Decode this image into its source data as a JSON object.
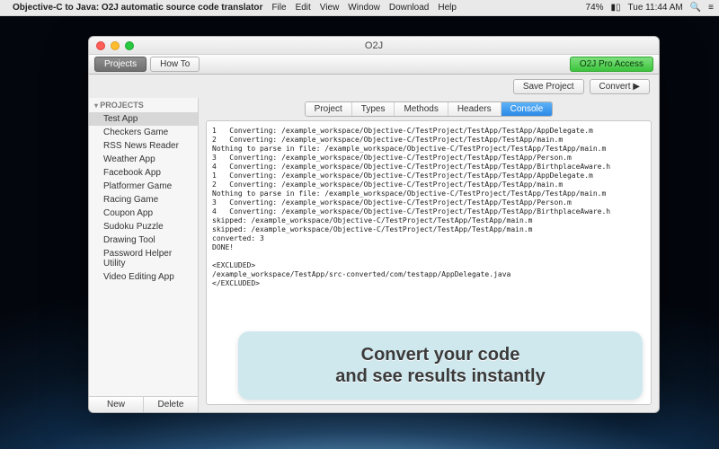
{
  "menubar": {
    "app_title": "Objective-C to Java: O2J automatic source code translator",
    "items": [
      "File",
      "Edit",
      "View",
      "Window",
      "Download",
      "Help"
    ],
    "battery": "74%",
    "clock": "Tue 11:44 AM"
  },
  "window": {
    "title": "O2J",
    "toolbar": {
      "tabs": [
        {
          "label": "Projects",
          "active": true
        },
        {
          "label": "How To",
          "active": false
        }
      ],
      "pro_button": "O2J Pro Access",
      "save_button": "Save Project",
      "convert_button": "Convert ▶"
    },
    "sidebar": {
      "header": "PROJECTS",
      "items": [
        "Test App",
        "Checkers Game",
        "RSS News Reader",
        "Weather App",
        "Facebook App",
        "Platformer Game",
        "Racing Game",
        "Coupon App",
        "Sudoku Puzzle",
        "Drawing Tool",
        "Password Helper Utility",
        "Video Editing App"
      ],
      "selected": 0,
      "new_button": "New",
      "delete_button": "Delete"
    },
    "segmented": [
      "Project",
      "Types",
      "Methods",
      "Headers",
      "Console"
    ],
    "segmented_active": 4,
    "console_output": "1   Converting: /example_workspace/Objective-C/TestProject/TestApp/TestApp/AppDelegate.m\n2   Converting: /example_workspace/Objective-C/TestProject/TestApp/TestApp/main.m\nNothing to parse in file: /example_workspace/Objective-C/TestProject/TestApp/TestApp/main.m\n3   Converting: /example_workspace/Objective-C/TestProject/TestApp/TestApp/Person.m\n4   Converting: /example_workspace/Objective-C/TestProject/TestApp/TestApp/BirthplaceAware.h\n1   Converting: /example_workspace/Objective-C/TestProject/TestApp/TestApp/AppDelegate.m\n2   Converting: /example_workspace/Objective-C/TestProject/TestApp/TestApp/main.m\nNothing to parse in file: /example_workspace/Objective-C/TestProject/TestApp/TestApp/main.m\n3   Converting: /example_workspace/Objective-C/TestProject/TestApp/TestApp/Person.m\n4   Converting: /example_workspace/Objective-C/TestProject/TestApp/TestApp/BirthplaceAware.h\nskipped: /example_workspace/Objective-C/TestProject/TestApp/TestApp/main.m\nskipped: /example_workspace/Objective-C/TestProject/TestApp/TestApp/main.m\nconverted: 3\nDONE!\n\n<EXCLUDED>\n/example_workspace/TestApp/src-converted/com/testapp/AppDelegate.java\n</EXCLUDED>"
  },
  "callout": {
    "line1": "Convert your code",
    "line2": "and see results instantly"
  }
}
